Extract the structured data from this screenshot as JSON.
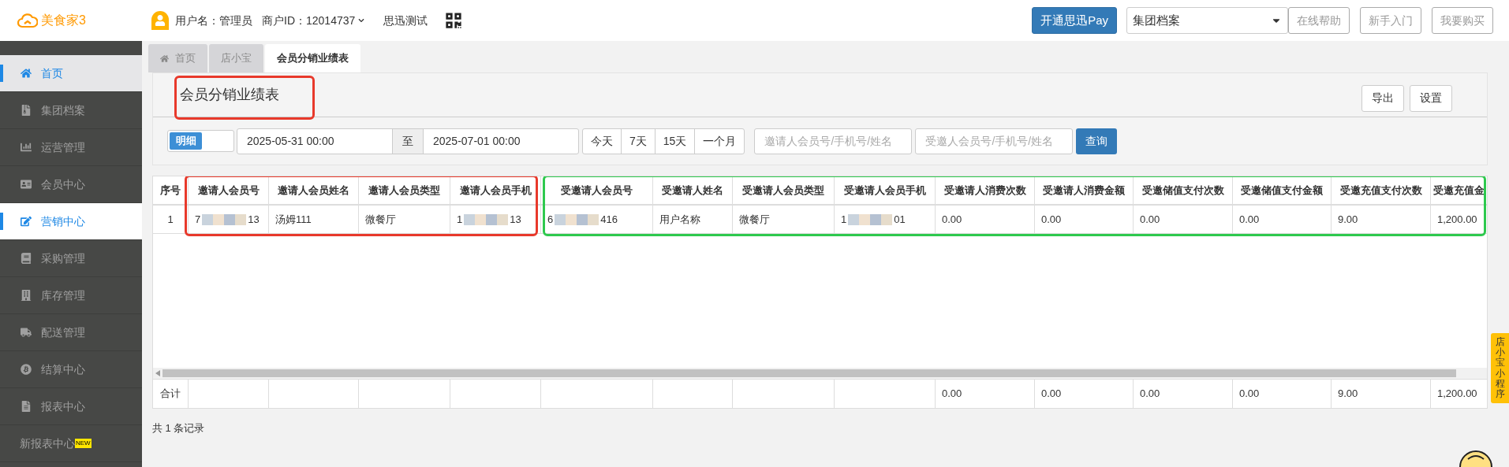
{
  "header": {
    "logo": "美食家3",
    "user": "用户名：管理员",
    "merchant": "商户ID：12014737",
    "store": "思迅测试",
    "pay_button": "开通思迅Pay",
    "select": {
      "value": "集团档案"
    },
    "buttons": [
      "在线帮助",
      "新手入门",
      "我要购买"
    ]
  },
  "sidebar": {
    "items": [
      {
        "label": "首页",
        "selected": false,
        "hovered": true
      },
      {
        "label": "集团档案",
        "selected": false,
        "hovered": false
      },
      {
        "label": "运营管理",
        "selected": false,
        "hovered": false
      },
      {
        "label": "会员中心",
        "selected": false,
        "hovered": false
      },
      {
        "label": "营销中心",
        "selected": true,
        "hovered": false
      },
      {
        "label": "采购管理",
        "selected": false,
        "hovered": false
      },
      {
        "label": "库存管理",
        "selected": false,
        "hovered": false
      },
      {
        "label": "配送管理",
        "selected": false,
        "hovered": false
      },
      {
        "label": "结算中心",
        "selected": false,
        "hovered": false
      },
      {
        "label": "报表中心",
        "selected": false,
        "hovered": false
      },
      {
        "label": "新报表中心",
        "selected": false,
        "hovered": false,
        "badge": "NEW"
      }
    ]
  },
  "tabs": [
    {
      "label": "首页",
      "selected": false
    },
    {
      "label": "店小宝",
      "selected": false
    },
    {
      "label": "会员分销业绩表",
      "selected": true
    }
  ],
  "page_title": "会员分销业绩表",
  "actions": [
    "导出",
    "设置"
  ],
  "filters": {
    "mode": {
      "label": "明细",
      "on": true
    },
    "date_from": "2025-05-31 00:00",
    "separator": "至",
    "date_to": "2025-07-01 00:00",
    "ranges": [
      "今天",
      "7天",
      "15天",
      "一个月"
    ],
    "inviter_search": {
      "placeholder": "邀请人会员号/手机号/姓名"
    },
    "invitee_search": {
      "placeholder": "受邀人会员号/手机号/姓名"
    },
    "query": "查询"
  },
  "table": {
    "columns": [
      "序号",
      "邀请人会员号",
      "邀请人会员姓名",
      "邀请人会员类型",
      "邀请人会员手机",
      "受邀请人会员号",
      "受邀请人姓名",
      "受邀请人会员类型",
      "受邀请人会员手机",
      "受邀请人消费次数",
      "受邀请人消费金额",
      "受邀储值支付次数",
      "受邀储值支付金额",
      "受邀充值支付次数",
      "受邀充值金"
    ],
    "rows": [
      {
        "cells": [
          {
            "kind": "text",
            "text": "1"
          },
          {
            "kind": "masked",
            "start": "7",
            "end": "13"
          },
          {
            "kind": "text",
            "text": "汤姆111"
          },
          {
            "kind": "text",
            "text": "微餐厅"
          },
          {
            "kind": "masked",
            "start": "1",
            "end": "13"
          },
          {
            "kind": "masked",
            "start": "6",
            "end": "416"
          },
          {
            "kind": "text",
            "text": "用户名称"
          },
          {
            "kind": "text",
            "text": "微餐厅"
          },
          {
            "kind": "masked",
            "start": "1",
            "end": "01"
          },
          {
            "kind": "text",
            "text": "0.00"
          },
          {
            "kind": "text",
            "text": "0.00"
          },
          {
            "kind": "text",
            "text": "0.00"
          },
          {
            "kind": "text",
            "text": "0.00"
          },
          {
            "kind": "text",
            "text": "9.00"
          },
          {
            "kind": "text",
            "text": "1,200.00"
          }
        ]
      }
    ],
    "total": {
      "label": "合计",
      "values": [
        "0.00",
        "0.00",
        "0.00",
        "0.00",
        "9.00",
        "1,200.00"
      ]
    }
  },
  "annotations": [
    {
      "color": "#e8392b"
    },
    {
      "color": "#e8392b"
    },
    {
      "color": "#2ec94e"
    }
  ],
  "record_count": "共 1 条记录",
  "side_tab": "店小宝小程序"
}
